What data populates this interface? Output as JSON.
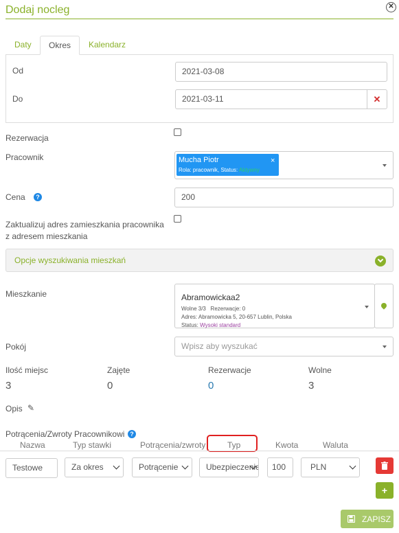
{
  "dialog": {
    "title": "Dodaj nocleg"
  },
  "tabs": [
    {
      "label": "Daty"
    },
    {
      "label": "Okres"
    },
    {
      "label": "Kalendarz"
    }
  ],
  "period": {
    "from_label": "Od",
    "from_value": "2021-03-08",
    "to_label": "Do",
    "to_value": "2021-03-11"
  },
  "reservation": {
    "label": "Rezerwacja",
    "checked": false
  },
  "employee": {
    "label": "Pracownik",
    "name": "Mucha Piotr",
    "meta_prefix": "Rola: pracownik, Status:",
    "status": "Aktywny"
  },
  "price": {
    "label": "Cena",
    "value": "200"
  },
  "update_address": {
    "label_line1": "Zaktualizuj adres zamieszkania pracownika",
    "label_line2": "z adresem mieszkania",
    "checked": false
  },
  "search_options": {
    "label": "Opcje wyszukiwania mieszkań"
  },
  "apartment": {
    "label": "Mieszkanie",
    "name": "Abramowickaa2",
    "counts": "Wolne 3/3   Rezerwacje: 0",
    "address": "Adres: Abramowicka 5, 20-657 Lublin, Polska",
    "status_prefix": "Status:",
    "status": "Wysoki standard"
  },
  "room": {
    "label": "Pokój",
    "placeholder": "Wpisz aby wyszukać"
  },
  "stats": [
    {
      "label": "Ilość miejsc",
      "value": "3"
    },
    {
      "label": "Zajęte",
      "value": "0"
    },
    {
      "label": "Rezerwacje",
      "value": "0"
    },
    {
      "label": "Wolne",
      "value": "3"
    }
  ],
  "description": {
    "label": "Opis"
  },
  "deductions": {
    "section_label": "Potrącenia/Zwroty Pracownikowi",
    "columns": [
      "Nazwa",
      "Typ stawki",
      "Potrącenia/zwroty",
      "Typ",
      "Kwota",
      "Waluta"
    ],
    "row": {
      "name": "Testowe",
      "rate_type": "Za okres",
      "kind": "Potrącenie",
      "type": "Ubezpieczenie",
      "amount": "100",
      "currency": "PLN"
    }
  },
  "save_button": {
    "label": "ZAPISZ"
  },
  "colors": {
    "accent": "#8ab12a",
    "selected_tag": "#2196f3",
    "delete": "#e53935",
    "highlight_border": "#e02020"
  }
}
